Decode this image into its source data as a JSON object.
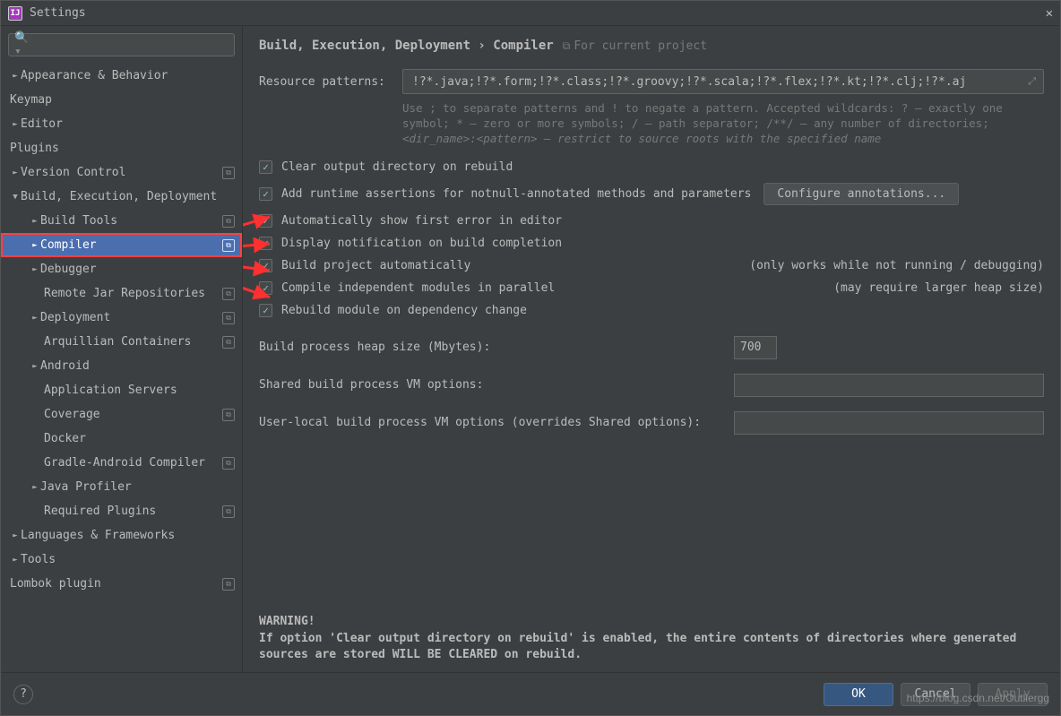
{
  "window": {
    "title": "Settings"
  },
  "search": {
    "placeholder": ""
  },
  "sidebar": {
    "items": [
      {
        "label": "Appearance & Behavior",
        "depth": 0,
        "caret": "►"
      },
      {
        "label": "Keymap",
        "depth": 0
      },
      {
        "label": "Editor",
        "depth": 0,
        "caret": "►"
      },
      {
        "label": "Plugins",
        "depth": 0
      },
      {
        "label": "Version Control",
        "depth": 0,
        "caret": "►",
        "proj": true
      },
      {
        "label": "Build, Execution, Deployment",
        "depth": 0,
        "caret": "▼"
      },
      {
        "label": "Build Tools",
        "depth": 1,
        "caret": "►",
        "proj": true
      },
      {
        "label": "Compiler",
        "depth": 1,
        "caret": "►",
        "proj": true,
        "selected": true
      },
      {
        "label": "Debugger",
        "depth": 1,
        "caret": "►"
      },
      {
        "label": "Remote Jar Repositories",
        "depth": 1,
        "proj": true
      },
      {
        "label": "Deployment",
        "depth": 1,
        "caret": "►",
        "proj": true
      },
      {
        "label": "Arquillian Containers",
        "depth": 1,
        "proj": true
      },
      {
        "label": "Android",
        "depth": 1,
        "caret": "►"
      },
      {
        "label": "Application Servers",
        "depth": 1
      },
      {
        "label": "Coverage",
        "depth": 1,
        "proj": true
      },
      {
        "label": "Docker",
        "depth": 1
      },
      {
        "label": "Gradle-Android Compiler",
        "depth": 1,
        "proj": true
      },
      {
        "label": "Java Profiler",
        "depth": 1,
        "caret": "►"
      },
      {
        "label": "Required Plugins",
        "depth": 1,
        "proj": true
      },
      {
        "label": "Languages & Frameworks",
        "depth": 0,
        "caret": "►"
      },
      {
        "label": "Tools",
        "depth": 0,
        "caret": "►"
      },
      {
        "label": "Lombok plugin",
        "depth": 0,
        "proj": true
      }
    ]
  },
  "breadcrumb": {
    "path": "Build, Execution, Deployment › Compiler",
    "scope": "For current project"
  },
  "resource_patterns": {
    "label": "Resource patterns:",
    "value": "!?*.java;!?*.form;!?*.class;!?*.groovy;!?*.scala;!?*.flex;!?*.kt;!?*.clj;!?*.aj",
    "help1": "Use ; to separate patterns and ! to negate a pattern. Accepted wildcards: ? — exactly one symbol; * — zero or more symbols; / — path separator; /**/ — any number of directories;",
    "help2": "<dir_name>:<pattern> — restrict to source roots with the specified name"
  },
  "checks": {
    "clear": {
      "label": "Clear output directory on rebuild",
      "checked": true
    },
    "notnull": {
      "label": "Add runtime assertions for notnull-annotated methods and parameters",
      "checked": true,
      "button": "Configure annotations..."
    },
    "autoerr": {
      "label": "Automatically show first error in editor",
      "checked": true
    },
    "notify": {
      "label": "Display notification on build completion",
      "checked": true
    },
    "autobuild": {
      "label": "Build project automatically",
      "checked": true,
      "hint": "(only works while not running / debugging)"
    },
    "parallel": {
      "label": "Compile independent modules in parallel",
      "checked": true,
      "hint": "(may require larger heap size)"
    },
    "rebuild": {
      "label": "Rebuild module on dependency change",
      "checked": true
    }
  },
  "fields": {
    "heap": {
      "label": "Build process heap size (Mbytes):",
      "value": "700"
    },
    "sharedvm": {
      "label": "Shared build process VM options:",
      "value": ""
    },
    "uservm": {
      "label": "User-local build process VM options (overrides Shared options):",
      "value": ""
    }
  },
  "warning": {
    "head": "WARNING!",
    "body": "If option 'Clear output directory on rebuild' is enabled, the entire contents of directories where generated sources are stored WILL BE CLEARED on rebuild."
  },
  "footer": {
    "ok": "OK",
    "cancel": "Cancel",
    "apply": "Apply"
  },
  "watermark": "https://blog.csdn.net/Outliergg"
}
